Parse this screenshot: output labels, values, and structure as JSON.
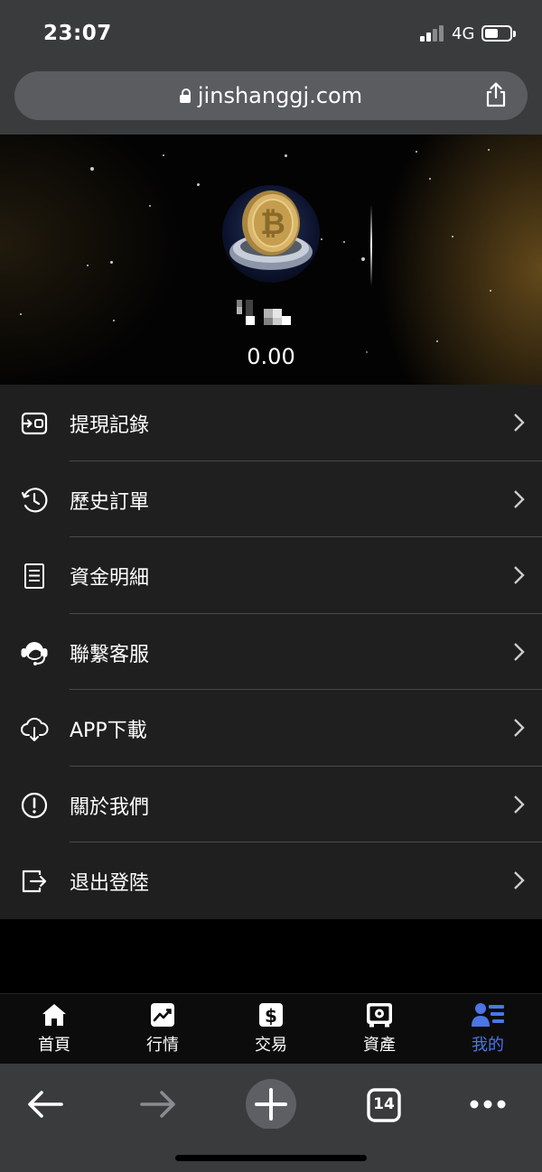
{
  "status_bar": {
    "time": "23:07",
    "network": "4G"
  },
  "browser": {
    "url": "jinshanggj.com",
    "tab_count": "14"
  },
  "hero": {
    "balance": "0.00"
  },
  "menu": {
    "items": [
      {
        "label": "提現記錄",
        "icon": "withdraw-record-icon"
      },
      {
        "label": "歷史訂單",
        "icon": "history-clock-icon"
      },
      {
        "label": "資金明細",
        "icon": "document-icon"
      },
      {
        "label": "聯繫客服",
        "icon": "customer-service-headset-icon"
      },
      {
        "label": "APP下載",
        "icon": "cloud-download-icon"
      },
      {
        "label": "關於我們",
        "icon": "info-circle-icon"
      },
      {
        "label": "退出登陸",
        "icon": "logout-icon"
      }
    ]
  },
  "tab_bar": {
    "tabs": [
      {
        "label": "首頁",
        "icon": "home-icon"
      },
      {
        "label": "行情",
        "icon": "chart-trend-icon"
      },
      {
        "label": "交易",
        "icon": "dollar-icon"
      },
      {
        "label": "資產",
        "icon": "safe-icon"
      },
      {
        "label": "我的",
        "icon": "profile-list-icon",
        "active": true
      }
    ]
  },
  "colors": {
    "accent": "#4a76e6",
    "menu_bg": "#1f1f1f",
    "browser_chrome": "#3a3b3d"
  }
}
